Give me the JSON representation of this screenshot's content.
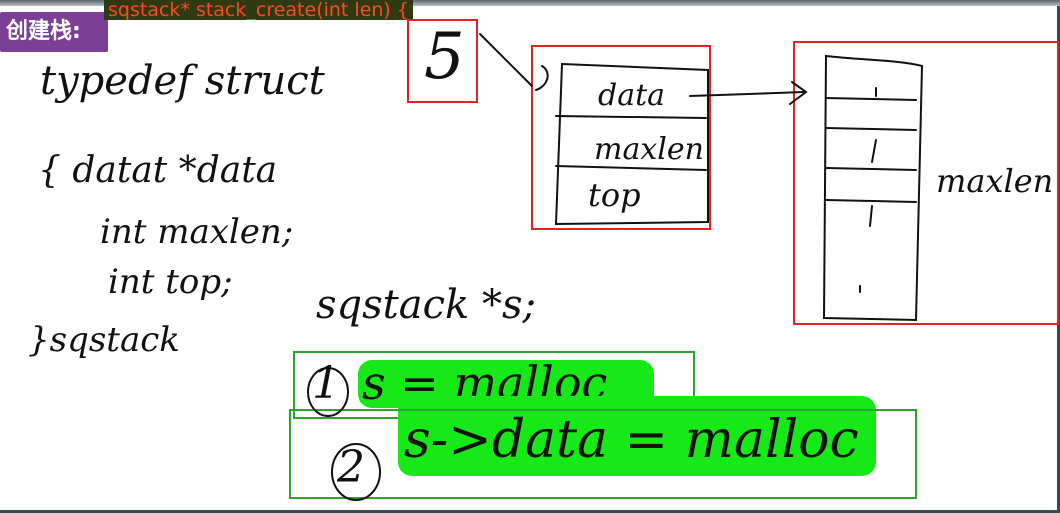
{
  "header": {
    "badge": "创建栈:",
    "function_signature": "sqstack* stack_create(int len) {"
  },
  "code_notes": {
    "line1": "typedef struct",
    "line2": "{  datat *data",
    "line3": "int maxlen;",
    "line4": "int top;",
    "line5": "}sqstack"
  },
  "diagram": {
    "pointer_value": "5",
    "struct_fields": [
      "data",
      "maxlen",
      "top"
    ],
    "array_label": "maxlen"
  },
  "steps": {
    "declaration": "sqstack *s;",
    "step1_number": "1",
    "step1_text": "s = malloc",
    "step2_number": "2",
    "step2_text": "s->data = malloc"
  },
  "colors": {
    "badge_bg": "#7b3f95",
    "title_text": "#ff4a1a",
    "red_box": "#e52222",
    "green_box": "#2aa42a",
    "highlight": "#17e817"
  }
}
